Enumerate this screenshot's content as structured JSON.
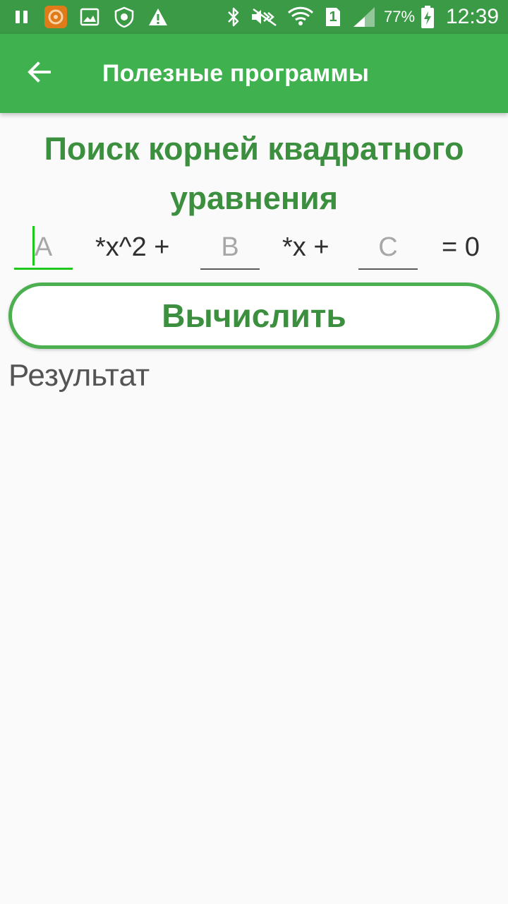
{
  "status_bar": {
    "battery_percent": "77%",
    "time": "12:39",
    "sim_slot": "1",
    "icons": [
      "pause-icon",
      "app-notification-icon",
      "image-icon",
      "security-shield-icon",
      "warning-icon",
      "bluetooth-icon",
      "mute-icon",
      "wifi-icon",
      "sim-icon",
      "signal-icon",
      "battery-charging-icon"
    ]
  },
  "app_bar": {
    "title": "Полезные программы",
    "back_icon": "arrow-back-icon"
  },
  "main": {
    "heading_line1": "Поиск корней квадратного",
    "heading_line2": "уравнения",
    "equation": {
      "a_placeholder": "A",
      "b_placeholder": "B",
      "c_placeholder": "C",
      "x2_term": "*x^2 +",
      "x_term": "*x +",
      "equals": "= 0"
    },
    "calculate_label": "Вычислить",
    "result_label": "Результат"
  },
  "colors": {
    "status_bar": "#3a9a45",
    "app_bar": "#3fb24f",
    "accent_green": "#3c8f3f",
    "button_border": "#4caf50",
    "focus_line": "#1ec81e",
    "background": "#fafafa"
  }
}
